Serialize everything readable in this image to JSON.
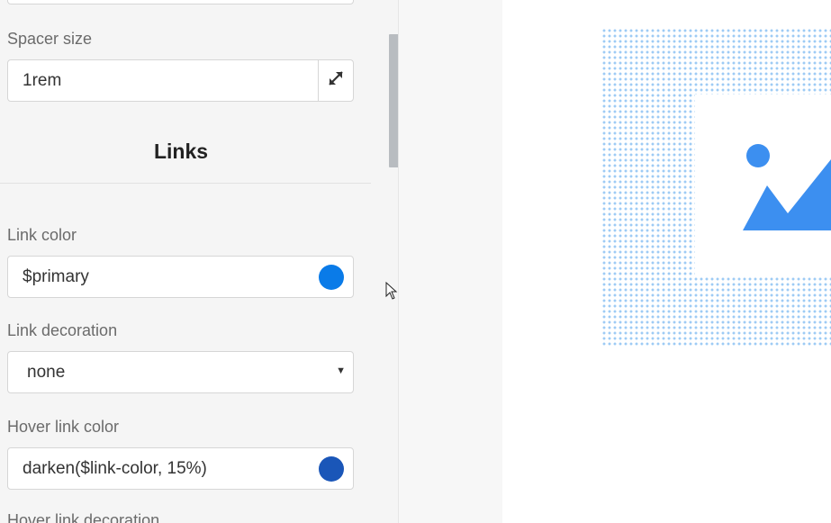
{
  "panel": {
    "spacer_size": {
      "label": "Spacer size",
      "value": "1rem"
    },
    "links_section_title": "Links",
    "link_color": {
      "label": "Link color",
      "value": "$primary",
      "swatch_color": "#0a7be8"
    },
    "link_decoration": {
      "label": "Link decoration",
      "value": "none"
    },
    "hover_link_color": {
      "label": "Hover link color",
      "value": "darken($link-color, 15%)",
      "swatch_color": "#1a56b8"
    },
    "hover_link_decoration": {
      "label": "Hover link decoration"
    }
  },
  "preview": {
    "dot_color": "#9ecbf5",
    "image_placeholder_color": "#3c8ff0"
  }
}
